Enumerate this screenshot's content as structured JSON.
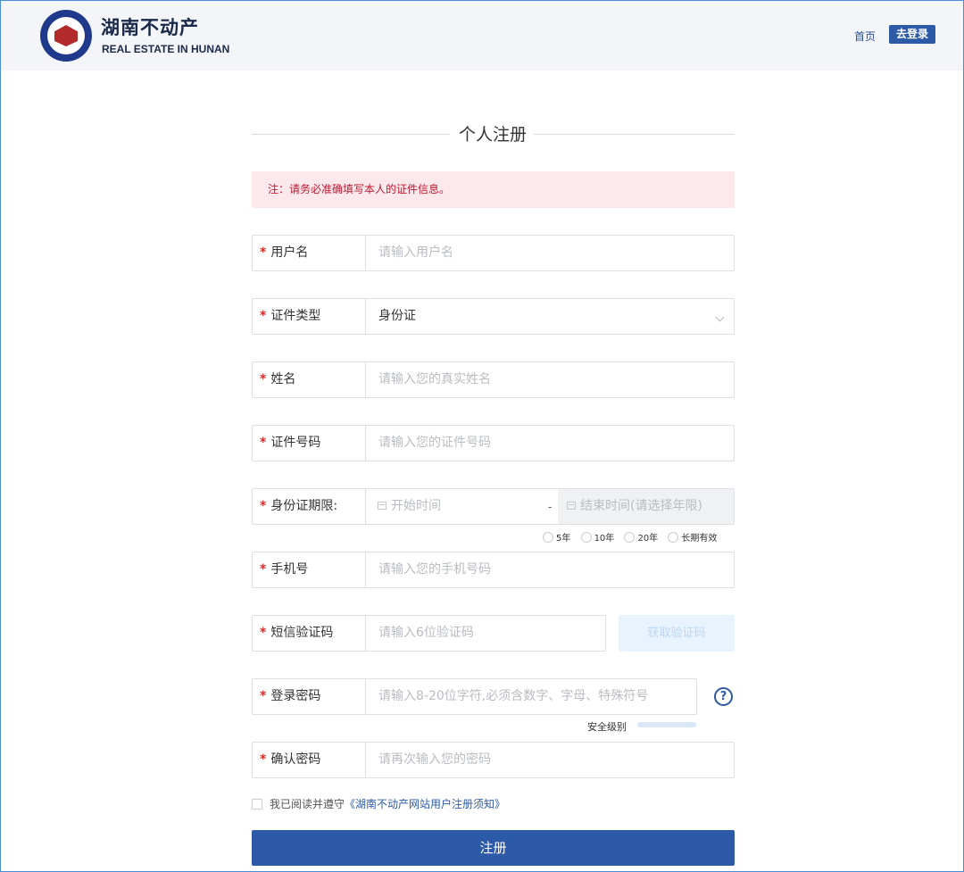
{
  "header": {
    "brand_title": "湖南不动产",
    "brand_subtitle": "REAL ESTATE IN HUNAN",
    "nav_home": "首页",
    "nav_login": "去登录"
  },
  "page_title": "个人注册",
  "notice": "注：请务必准确填写本人的证件信息。",
  "form": {
    "username": {
      "label": "用户名",
      "placeholder": "请输入用户名"
    },
    "id_type": {
      "label": "证件类型",
      "value": "身份证"
    },
    "name": {
      "label": "姓名",
      "placeholder": "请输入您的真实姓名"
    },
    "id_number": {
      "label": "证件号码",
      "placeholder": "请输入您的证件号码"
    },
    "id_validity": {
      "label": "身份证期限:",
      "start_placeholder": "开始时间",
      "separator": "-",
      "end_placeholder": "结束时间(请选择年限)",
      "options": [
        "5年",
        "10年",
        "20年",
        "长期有效"
      ]
    },
    "phone": {
      "label": "手机号",
      "placeholder": "请输入您的手机号码"
    },
    "sms_code": {
      "label": "短信验证码",
      "placeholder": "请输入6位验证码",
      "button": "获取验证码"
    },
    "password": {
      "label": "登录密码",
      "placeholder": "请输入8-20位字符,必须含数字、字母、特殊符号",
      "help": "?",
      "strength_label": "安全级别"
    },
    "confirm_password": {
      "label": "确认密码",
      "placeholder": "请再次输入您的密码"
    },
    "required_mark": "*"
  },
  "agreement": {
    "prefix": "我已阅读并遵守",
    "link": "《湖南不动产网站用户注册须知》"
  },
  "submit_label": "注册"
}
